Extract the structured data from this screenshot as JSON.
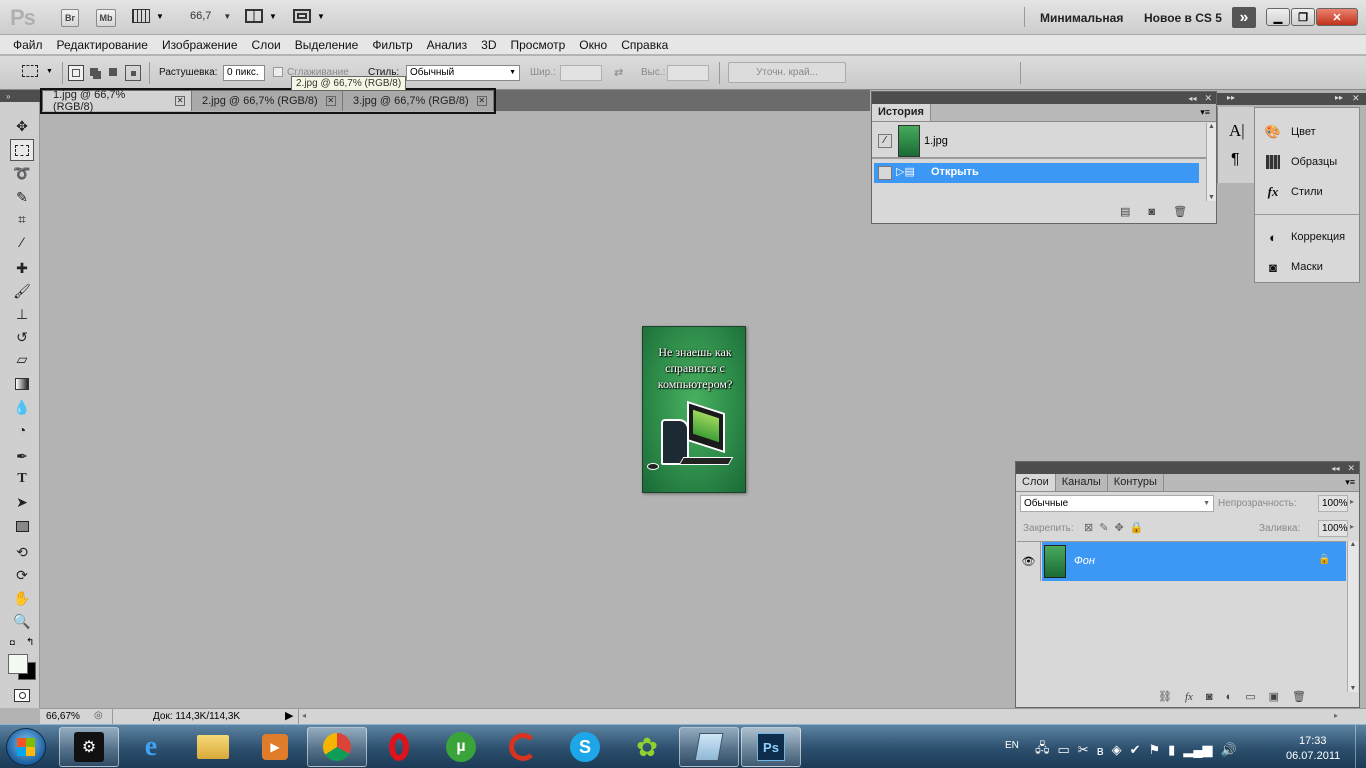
{
  "app": {
    "logo": "Ps",
    "bridge_label": "Br",
    "minibridge_label": "Mb",
    "zoom": "66,7",
    "workspaces": [
      "Минимальная",
      "Новое в CS 5"
    ],
    "more_label": "»"
  },
  "menu": [
    "Файл",
    "Редактирование",
    "Изображение",
    "Слои",
    "Выделение",
    "Фильтр",
    "Анализ",
    "3D",
    "Просмотр",
    "Окно",
    "Справка"
  ],
  "options": {
    "feather_label": "Растушевка:",
    "feather_value": "0 пикс.",
    "antialias_label": "Сглаживание",
    "style_label": "Стиль:",
    "style_value": "Обычный",
    "width_label": "Шир.:",
    "height_label": "Выс.:",
    "refine_edge": "Уточн. край..."
  },
  "tabs": [
    {
      "label": "1.jpg @ 66,7% (RGB/8)",
      "close": "✕"
    },
    {
      "label": "2.jpg @ 66,7% (RGB/8)",
      "close": "✕"
    },
    {
      "label": "3.jpg @ 66,7% (RGB/8)",
      "close": "✕"
    }
  ],
  "tooltip": "2.jpg @ 66,7% (RGB/8)",
  "canvas_image": {
    "text": "Не знаешь как справится с компьютером?"
  },
  "history": {
    "title": "История",
    "snapshot": "1.jpg",
    "action": "Открыть"
  },
  "right_panels": {
    "tools": [
      "Цвет",
      "Образцы",
      "Стили",
      "Коррекция",
      "Маски"
    ]
  },
  "layers": {
    "tabs": [
      "Слои",
      "Каналы",
      "Контуры"
    ],
    "blend_mode": "Обычные",
    "opacity_label": "Непрозрачность:",
    "opacity_value": "100%",
    "lock_label": "Закрепить:",
    "fill_label": "Заливка:",
    "fill_value": "100%",
    "layer_name": "Фон"
  },
  "status": {
    "zoom": "66,67%",
    "doc": "Док: 114,3K/114,3K"
  },
  "taskbar": {
    "lang": "EN",
    "time": "17:33",
    "date": "06.07.2011"
  },
  "colors": {
    "accent": "#3d97f5",
    "canvas_bg": "#b3b3b3",
    "image_green": "#2e8c4a"
  }
}
